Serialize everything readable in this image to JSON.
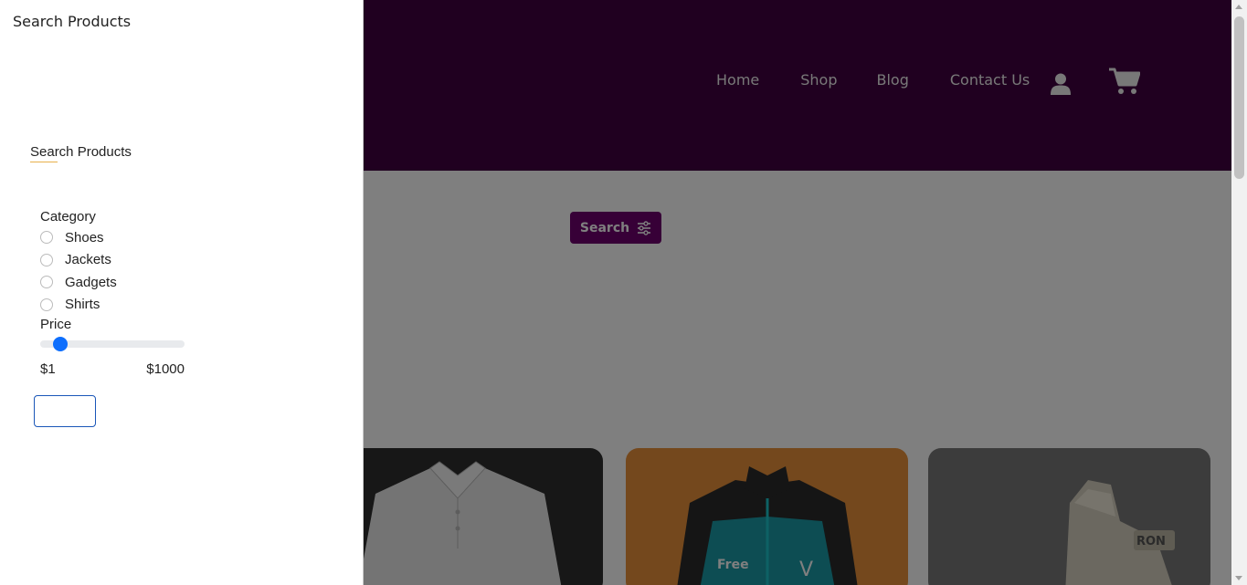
{
  "panel": {
    "title": "Search Products",
    "subtitle": "Search Products",
    "category_label": "Category",
    "categories": [
      "Shoes",
      "Jackets",
      "Gadgets",
      "Shirts"
    ],
    "price_label": "Price",
    "price_min": "$1",
    "price_max": "$1000",
    "price_slider_level": 0.1
  },
  "nav": {
    "items": [
      "Home",
      "Shop",
      "Blog",
      "Contact Us"
    ]
  },
  "search_button": {
    "label": "Search"
  },
  "colors": {
    "header": "#400040",
    "button": "#6e006e",
    "accent": "#0d6efd"
  }
}
